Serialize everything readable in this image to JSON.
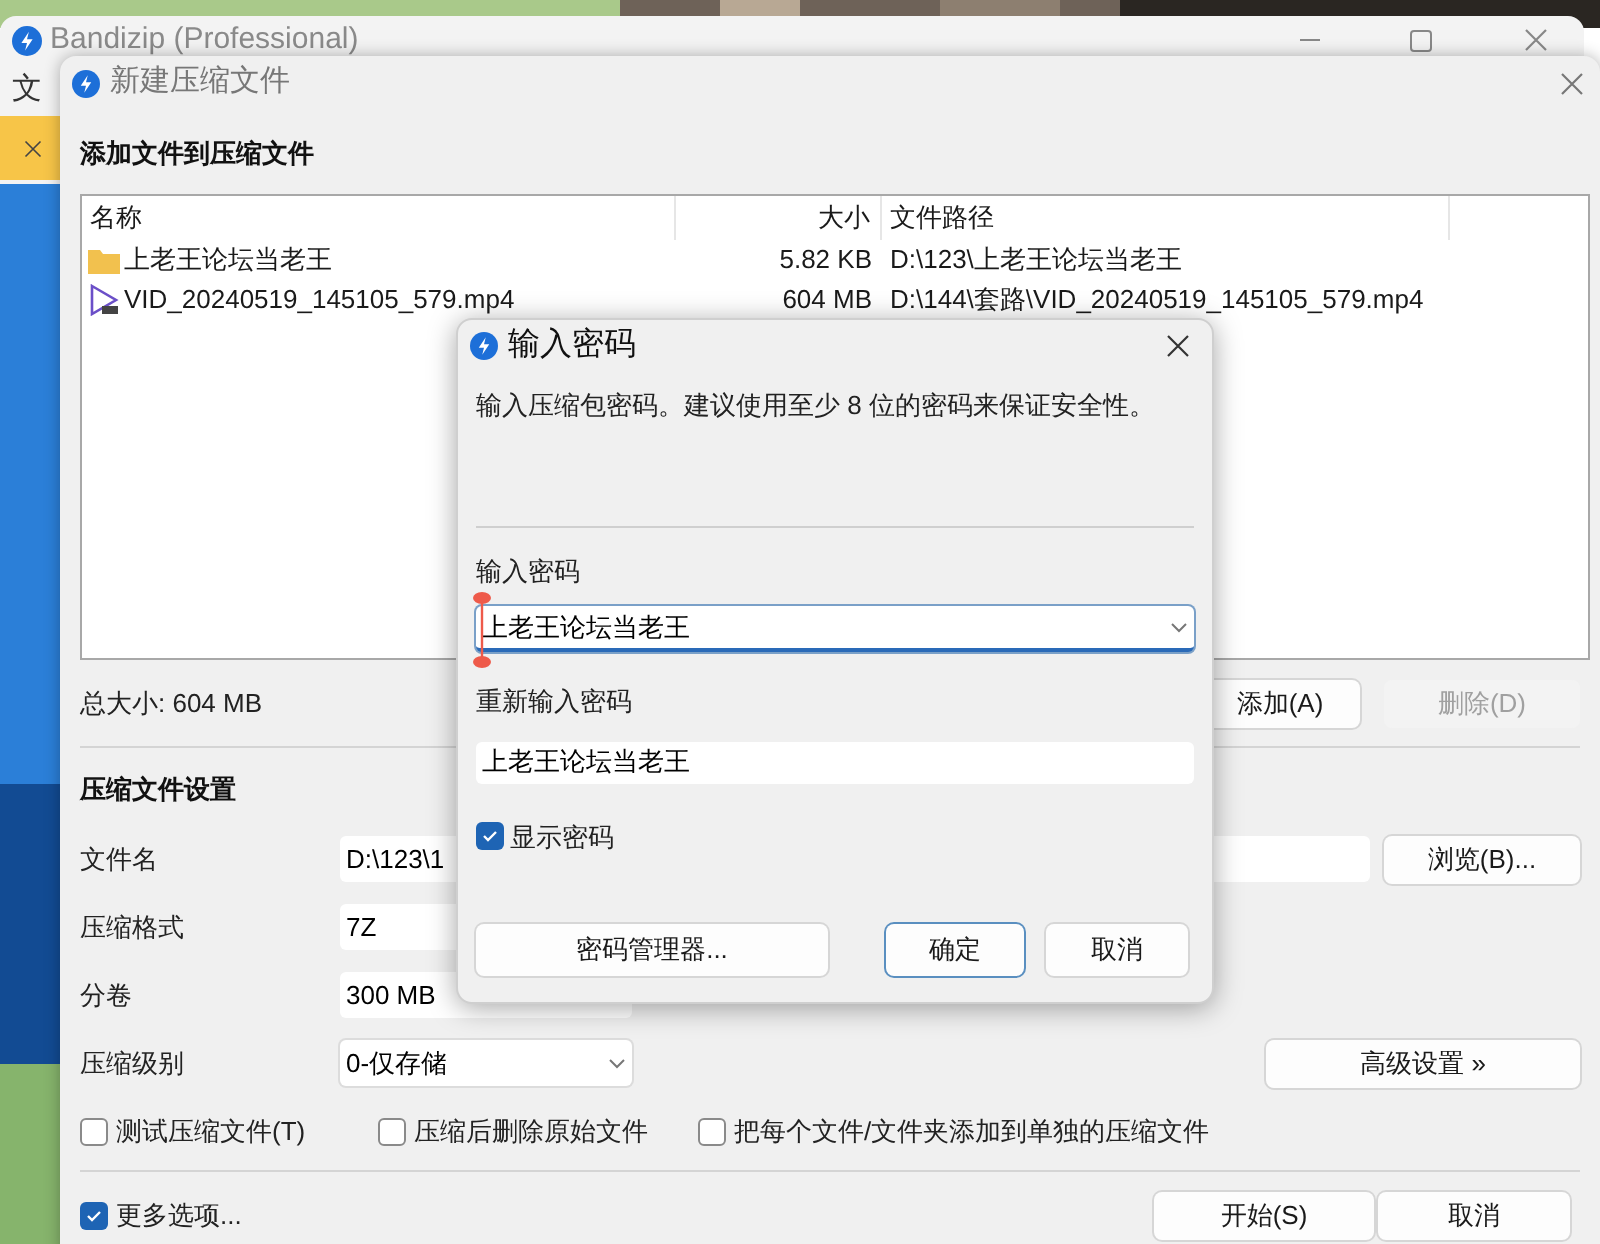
{
  "background_window": {
    "title": "Bandizip (Professional)",
    "menu": [
      "文"
    ]
  },
  "dialog": {
    "title": "新建压缩文件",
    "files_heading": "添加文件到压缩文件",
    "columns": [
      "名称",
      "大小",
      "文件路径"
    ],
    "rows": [
      {
        "kind": "folder",
        "name": "上老王论坛当老王",
        "size": "5.82 KB",
        "path": "D:\\123\\上老王论坛当老王"
      },
      {
        "kind": "video",
        "name": "VID_20240519_145105_579.mp4",
        "size": "604 MB",
        "path": "D:\\144\\套路\\VID_20240519_145105_579.mp4"
      }
    ],
    "total_size": "总大小: 604 MB",
    "list_buttons": [
      {
        "label": "添加(A)",
        "disabled": false
      },
      {
        "label": "删除(D)",
        "disabled": true
      }
    ],
    "settings_heading": "压缩文件设置",
    "fields": [
      {
        "kind": "text",
        "label": "文件名",
        "value": "D:\\123\\1"
      },
      {
        "kind": "text",
        "label": "压缩格式",
        "value": "7Z"
      },
      {
        "kind": "text",
        "label": "分卷",
        "value": "300 MB"
      },
      {
        "kind": "dropdown",
        "label": "压缩级别",
        "value": "0-仅存储"
      }
    ],
    "browse_button": "浏览(B)...",
    "advanced_button": "高级设置 »",
    "options": [
      {
        "label": "测试压缩文件(T)",
        "checked": false
      },
      {
        "label": "压缩后删除原始文件",
        "checked": false
      },
      {
        "label": "把每个文件/文件夹添加到单独的压缩文件",
        "checked": false
      }
    ],
    "more_options": {
      "label": "更多选项...",
      "checked": true
    },
    "footer_buttons": [
      "开始(S)",
      "取消"
    ]
  },
  "password_dialog": {
    "title": "输入密码",
    "description": "输入压缩包密码。建议使用至少 8 位的密码来保证安全性。",
    "password_label": "输入密码",
    "password_value": "上老王论坛当老王",
    "confirm_label": "重新输入密码",
    "confirm_value": "上老王论坛当老王",
    "show_password": {
      "label": "显示密码",
      "checked": true
    },
    "buttons": [
      {
        "label": "密码管理器...",
        "default": false
      },
      {
        "label": "确定",
        "default": true
      },
      {
        "label": "取消",
        "default": false
      }
    ]
  }
}
